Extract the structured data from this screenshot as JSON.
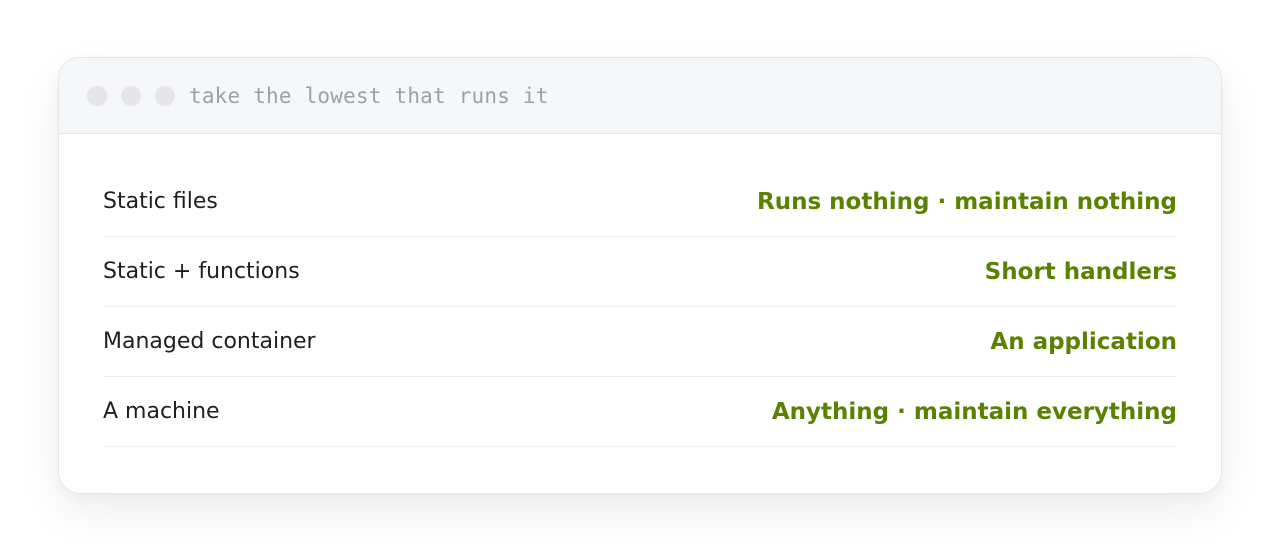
{
  "window": {
    "title": "take the lowest that runs it",
    "dot_color": "#e4e6e9"
  },
  "rows": [
    {
      "label": "Static files",
      "value": "Runs nothing · maintain nothing"
    },
    {
      "label": "Static + functions",
      "value": "Short handlers"
    },
    {
      "label": "Managed container",
      "value": "An application"
    },
    {
      "label": "A machine",
      "value": "Anything · maintain everything"
    }
  ],
  "colors": {
    "accent": "#5a8200",
    "label": "#1f1f1f",
    "title": "#9ca1a9"
  }
}
